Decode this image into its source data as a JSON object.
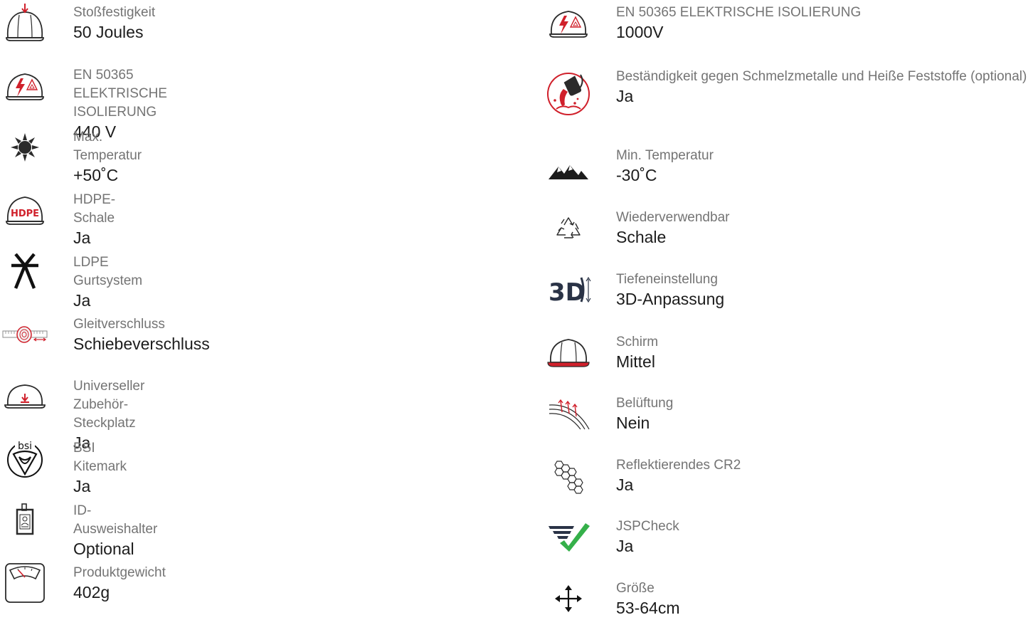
{
  "left_specs": [
    {
      "icon": "impact-helmet-icon",
      "label": "Stoßfestigkeit",
      "value": "50 Joules"
    },
    {
      "icon": "electrical-insulation-helmet-icon",
      "label": "EN 50365 ELEKTRISCHE ISOLIERUNG",
      "value": "440 V"
    },
    {
      "icon": "sun-icon",
      "label": "Max. Temperatur",
      "value": "+50˚C"
    },
    {
      "icon": "hdpe-helmet-icon",
      "label": "HDPE-Schale",
      "value": "Ja",
      "icon_text": "HDPE"
    },
    {
      "icon": "harness-asterisk-icon",
      "label": "LDPE Gurtsystem",
      "value": "Ja"
    },
    {
      "icon": "slide-lock-icon",
      "label": "Gleitverschluss",
      "value": "Schiebeverschluss"
    },
    {
      "icon": "accessory-slot-helmet-icon",
      "label": "Universeller Zubehör-Steckplatz",
      "value": "Ja"
    },
    {
      "icon": "bsi-kitemark-icon",
      "label": "BSI Kitemark",
      "value": "Ja",
      "icon_text": "bsi"
    },
    {
      "icon": "id-badge-holder-icon",
      "label": "ID-Ausweishalter",
      "value": "Optional"
    },
    {
      "icon": "weight-scale-icon",
      "label": "Produktgewicht",
      "value": "402g"
    }
  ],
  "right_specs": [
    {
      "icon": "electrical-insulation-helmet-icon",
      "label": "EN 50365 ELEKTRISCHE ISOLIERUNG",
      "value": "1000V"
    },
    {
      "icon": "molten-metal-icon",
      "label": "Beständigkeit gegen Schmelzmetalle und Heiße Feststoffe (optional)",
      "value": "Ja"
    },
    {
      "icon": "mountains-icon",
      "label": "Min. Temperatur",
      "value": "-30˚C"
    },
    {
      "icon": "recycle-icon",
      "label": "Wiederverwendbar",
      "value": "Schale"
    },
    {
      "icon": "depth-3d-icon",
      "label": "Tiefeneinstellung",
      "value": "3D-Anpassung",
      "icon_text": "3D"
    },
    {
      "icon": "brim-helmet-icon",
      "label": "Schirm",
      "value": "Mittel"
    },
    {
      "icon": "ventilation-icon",
      "label": "Belüftung",
      "value": "Nein"
    },
    {
      "icon": "reflective-hexagons-icon",
      "label": "Reflektierendes CR2",
      "value": "Ja"
    },
    {
      "icon": "jspcheck-icon",
      "label": "JSPCheck",
      "value": "Ja"
    },
    {
      "icon": "size-move-arrows-icon",
      "label": "Größe",
      "value": "53-64cm"
    }
  ],
  "colors": {
    "accent_red": "#d0202b",
    "icon_dark": "#2b2b2b",
    "navy": "#2a3346",
    "check_green": "#35b04a",
    "label_gray": "#747474",
    "value_dark": "#1c1c1c"
  }
}
